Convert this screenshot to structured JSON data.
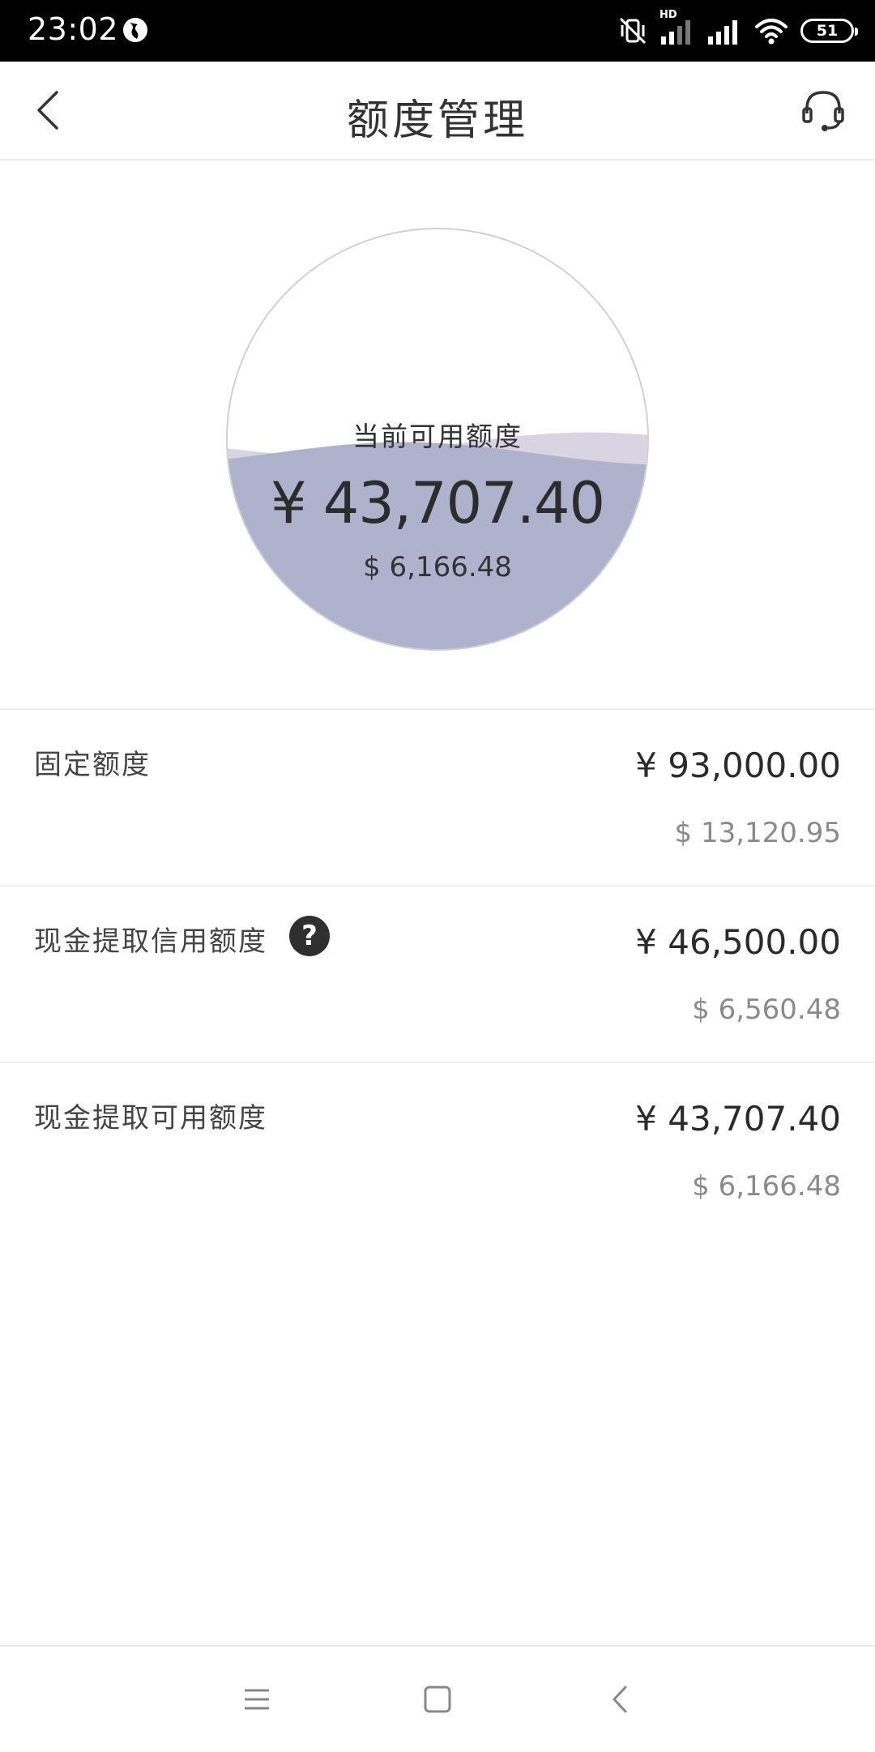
{
  "status_bar": {
    "time": "23:02",
    "hd_label": "HD",
    "battery": "51",
    "icons": [
      "globe-icon",
      "vibrate-off-icon",
      "signal-hd-icon",
      "signal-icon",
      "wifi-icon",
      "battery-icon"
    ]
  },
  "header": {
    "title": "额度管理",
    "back_icon": "chevron-left-icon",
    "support_icon": "headset-icon"
  },
  "available": {
    "label": "当前可用额度",
    "cny": "¥ 43,707.40",
    "usd": "$ 6,166.48",
    "fill_ratio": 0.47,
    "colors": {
      "fill": "#aeb2cc",
      "wave": "#d9d4e1",
      "outline": "#d0d0d0"
    }
  },
  "rows": [
    {
      "label": "固定额度",
      "cny": "¥ 93,000.00",
      "usd": "$ 13,120.95",
      "help": false
    },
    {
      "label": "现金提取信用额度",
      "cny": "¥ 46,500.00",
      "usd": "$ 6,560.48",
      "help": true,
      "help_glyph": "?"
    },
    {
      "label": "现金提取可用额度",
      "cny": "¥ 43,707.40",
      "usd": "$ 6,166.48",
      "help": false
    }
  ],
  "system_nav": {
    "icons": [
      "menu-icon",
      "home-square-icon",
      "back-icon"
    ]
  }
}
